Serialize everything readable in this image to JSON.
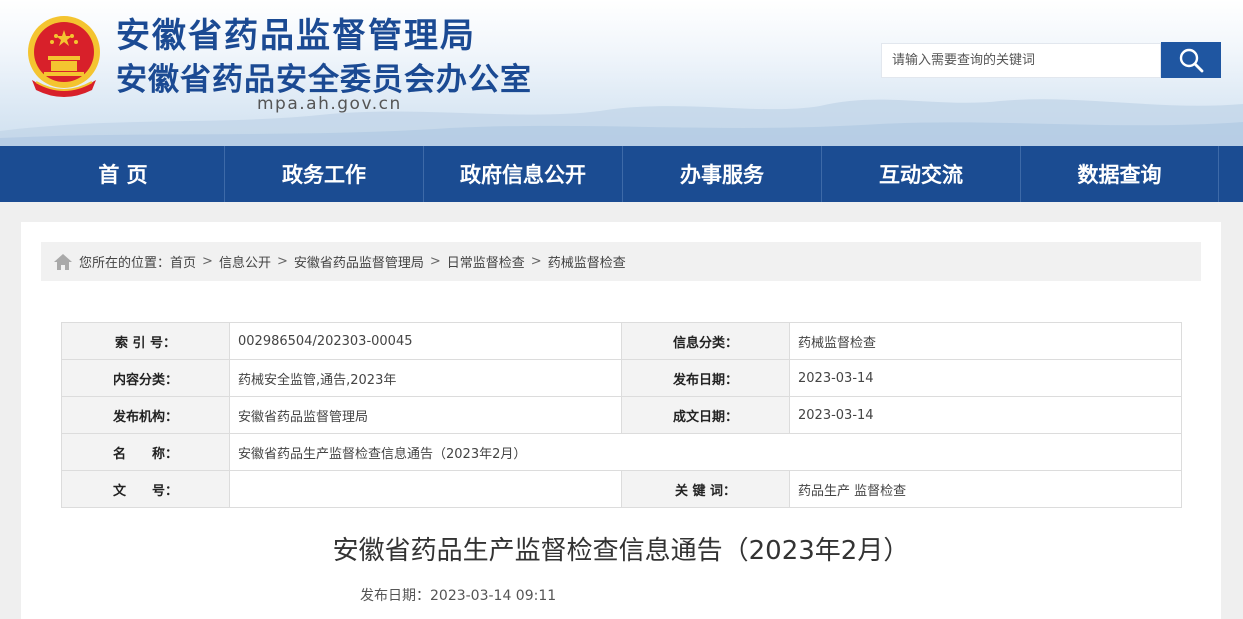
{
  "header": {
    "title": "安徽省药品监督管理局",
    "subtitle": "安徽省药品安全委员会办公室",
    "domain": "mpa.ah.gov.cn",
    "search_placeholder": "请输入需要查询的关键词"
  },
  "nav": {
    "items": [
      {
        "label": "首 页"
      },
      {
        "label": "政务工作"
      },
      {
        "label": "政府信息公开"
      },
      {
        "label": "办事服务"
      },
      {
        "label": "互动交流"
      },
      {
        "label": "数据查询"
      }
    ]
  },
  "breadcrumb": {
    "prefix": "您所在的位置：",
    "items": [
      "首页",
      "信息公开",
      "安徽省药品监督管理局",
      "日常监督检查",
      "药械监督检查"
    ],
    "separator": ">"
  },
  "meta": {
    "index_label": "索 引 号：",
    "index_value": "002986504/202303-00045",
    "category_label": "信息分类：",
    "category_value": "药械监督检查",
    "content_label": "内容分类：",
    "content_value": "药械安全监管,通告,2023年",
    "publish_label": "发布日期：",
    "publish_value": "2023-03-14",
    "org_label": "发布机构：",
    "org_value": "安徽省药品监督管理局",
    "created_label": "成文日期：",
    "created_value": "2023-03-14",
    "name_label": "名　　称：",
    "name_value": "安徽省药品生产监督检查信息通告（2023年2月）",
    "docno_label": "文　　号：",
    "docno_value": "",
    "keywords_label": "关 键 词：",
    "keywords_value": "药品生产 监督检查"
  },
  "article": {
    "title": "安徽省药品生产监督检查信息通告（2023年2月）",
    "date_label": "发布日期：",
    "date_value": "2023-03-14 09:11"
  },
  "colors": {
    "brand_blue": "#1b4c92",
    "title_blue": "#1b4a93",
    "search_button": "#1f56a1",
    "emblem_red": "#d8202a",
    "emblem_gold": "#f4c430"
  }
}
